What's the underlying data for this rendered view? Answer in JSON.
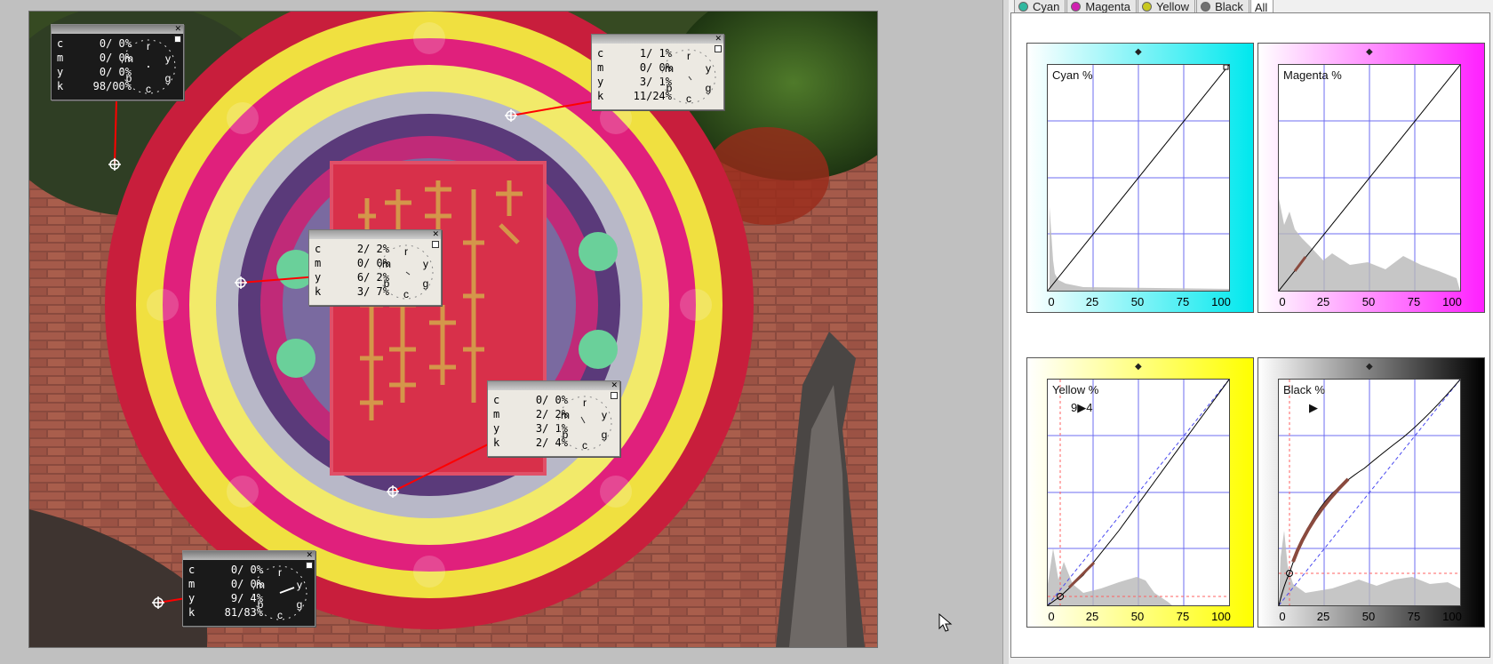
{
  "tabs": [
    {
      "label": "Cyan",
      "dot": "#30b8a0"
    },
    {
      "label": "Magenta",
      "dot": "#d020b0"
    },
    {
      "label": "Yellow",
      "dot": "#c8c820"
    },
    {
      "label": "Black",
      "dot": "#707070"
    },
    {
      "label": "All",
      "dot": ""
    }
  ],
  "probes": [
    {
      "c": "0/ 0%",
      "m": "0/ 0%",
      "y": "0/ 0%",
      "k": "98/00%"
    },
    {
      "c": "1/ 1%",
      "m": "0/ 0%",
      "y": "3/ 1%",
      "k": "11/24%"
    },
    {
      "c": "2/ 2%",
      "m": "0/ 0%",
      "y": "6/ 2%",
      "k": "3/ 7%"
    },
    {
      "c": "0/ 0%",
      "m": "2/ 2%",
      "y": "3/ 1%",
      "k": "2/ 4%"
    },
    {
      "c": "0/ 0%",
      "m": "0/ 0%",
      "y": "9/ 4%",
      "k": "81/83%"
    }
  ],
  "channel_letters": {
    "c": "c",
    "m": "m",
    "y": "y",
    "k": "k"
  },
  "dial_letters": {
    "r": "r",
    "y": "y",
    "g": "g",
    "c": "c",
    "b": "b",
    "m": "m"
  },
  "curves": [
    {
      "title": "Cyan %",
      "annotation": ""
    },
    {
      "title": "Magenta %",
      "annotation": ""
    },
    {
      "title": "Yellow %",
      "annotation": "9▶4"
    },
    {
      "title": "Black %",
      "annotation": "▶"
    }
  ],
  "axis_ticks": [
    "0",
    "25",
    "50",
    "75",
    "100"
  ],
  "colors": {
    "cyan": "#00e8ee",
    "magenta": "#ff20ff",
    "yellow": "#ffff00",
    "black": "#000000",
    "grid": "#6c6cf0",
    "probe_line": "#ff0000"
  }
}
